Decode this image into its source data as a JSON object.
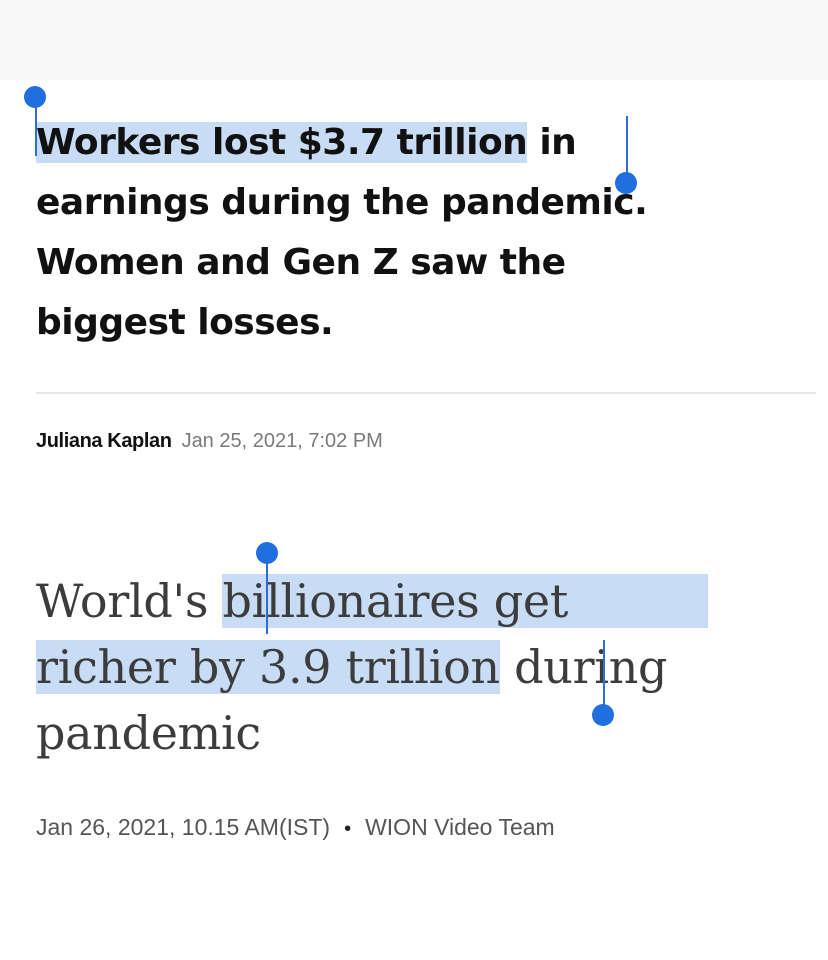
{
  "article1": {
    "headline_selected": "Workers lost $3.7 trillion",
    "headline_rest_line1": " in",
    "headline_line2": "earnings during the pandemic.",
    "headline_line3": "Women and Gen Z saw the",
    "headline_line4": "biggest losses.",
    "author": "Juliana Kaplan",
    "date": "Jan 25, 2021, 7:02 PM"
  },
  "article2": {
    "headline_prefix": "World's ",
    "headline_selected_line1": "billionaires get",
    "headline_selected_line2": "richer by 3.9 trillion",
    "headline_rest_line2": " during",
    "headline_line3": "pandemic",
    "date": "Jan 26, 2021, 10.15 AM(IST)",
    "bullet": "•",
    "source": "WION Video Team"
  },
  "colors": {
    "selection_highlight": "#c9dcf5",
    "selection_handle": "#1f6fe0"
  }
}
